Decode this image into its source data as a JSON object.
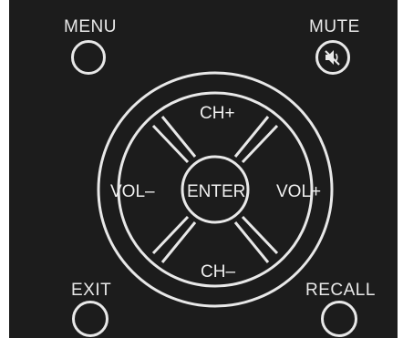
{
  "remote": {
    "menu_label": "MENU",
    "mute_label": "MUTE",
    "exit_label": "EXIT",
    "recall_label": "RECALL",
    "mute_icon": "speaker-muted-icon"
  },
  "dpad": {
    "up_label": "CH+",
    "down_label": "CH–",
    "left_label": "VOL–",
    "right_label": "VOL+",
    "center_label": "ENTER"
  },
  "colors": {
    "body": "#1c1c1c",
    "line": "#e8e8e8"
  }
}
